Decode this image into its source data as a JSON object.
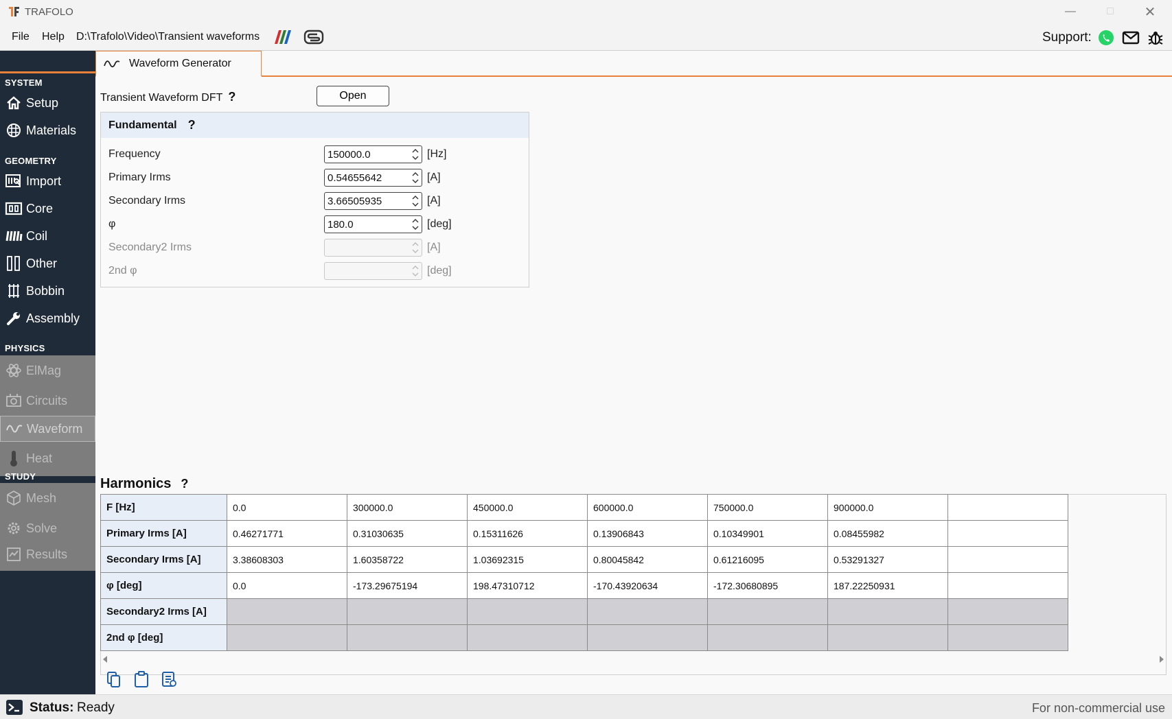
{
  "window": {
    "title": "TRAFOLO"
  },
  "menu": {
    "file": "File",
    "help": "Help",
    "path": "D:\\Trafolo\\Video\\Transient waveforms",
    "support": "Support:"
  },
  "sidebar": {
    "sections": {
      "system": "SYSTEM",
      "geometry": "GEOMETRY",
      "physics": "PHYSICS",
      "study": "STUDY"
    },
    "items": {
      "setup": "Setup",
      "materials": "Materials",
      "import": "Import",
      "core": "Core",
      "coil": "Coil",
      "other": "Other",
      "bobbin": "Bobbin",
      "assembly": "Assembly",
      "elmag": "ElMag",
      "circuits": "Circuits",
      "waveform": "Waveform",
      "heat": "Heat",
      "mesh": "Mesh",
      "solve": "Solve",
      "results": "Results"
    }
  },
  "tab": {
    "label": "Waveform Generator"
  },
  "dft": {
    "label": "Transient Waveform DFT",
    "help": "?",
    "open_button": "Open"
  },
  "fundamental": {
    "title": "Fundamental",
    "help": "?",
    "rows": [
      {
        "label": "Frequency",
        "value": "150000.0",
        "unit": "[Hz]"
      },
      {
        "label": "Primary Irms",
        "value": "0.54655642",
        "unit": "[A]"
      },
      {
        "label": "Secondary Irms",
        "value": "3.66505935",
        "unit": "[A]"
      },
      {
        "label": "φ",
        "value": "180.0",
        "unit": "[deg]"
      },
      {
        "label": "Secondary2 Irms",
        "value": "",
        "unit": "[A]"
      },
      {
        "label": "2nd φ",
        "value": "",
        "unit": "[deg]"
      }
    ]
  },
  "harmonics": {
    "title": "Harmonics",
    "help": "?",
    "rows": [
      {
        "header": "F [Hz]",
        "cells": [
          "0.0",
          "300000.0",
          "450000.0",
          "600000.0",
          "750000.0",
          "900000.0",
          ""
        ]
      },
      {
        "header": "Primary Irms [A]",
        "cells": [
          "0.46271771",
          "0.31030635",
          "0.15311626",
          "0.13906843",
          "0.10349901",
          "0.08455982",
          ""
        ]
      },
      {
        "header": "Secondary Irms [A]",
        "cells": [
          "3.38608303",
          "1.60358722",
          "1.03692315",
          "0.80045842",
          "0.61216095",
          "0.53291327",
          ""
        ]
      },
      {
        "header": "φ [deg]",
        "cells": [
          "0.0",
          "-173.29675194",
          "198.47310712",
          "-170.43920634",
          "-172.30680895",
          "187.22250931",
          ""
        ]
      },
      {
        "header": "Secondary2 Irms [A]",
        "cells": [
          "",
          "",
          "",
          "",
          "",
          "",
          ""
        ]
      },
      {
        "header": "2nd φ [deg]",
        "cells": [
          "",
          "",
          "",
          "",
          "",
          "",
          ""
        ]
      }
    ]
  },
  "status": {
    "label": "Status:",
    "value": "Ready",
    "license": "For non-commercial use"
  },
  "colors": {
    "accent": "#e8813a",
    "sidebar": "#1f2b38",
    "header_fill": "#e7eef8"
  }
}
